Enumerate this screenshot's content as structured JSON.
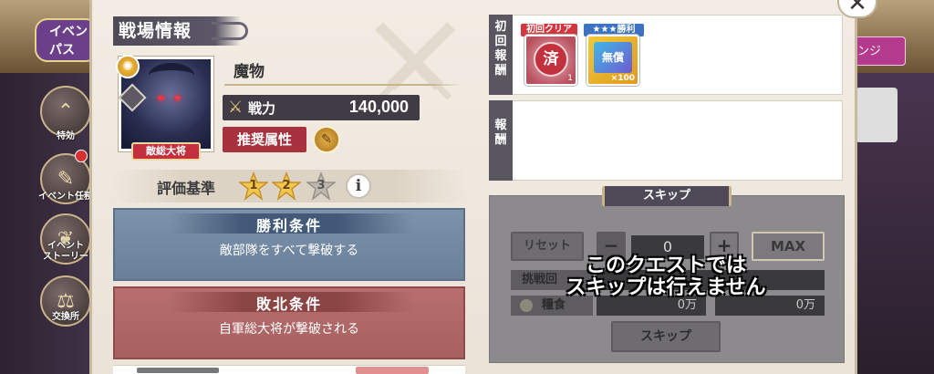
{
  "background": {
    "event_pass_label": "イベン\nパス",
    "change_label": "ンジ",
    "sidebar": [
      {
        "label": "特効",
        "icon": "chevron-up-icon"
      },
      {
        "label": "イベント任務",
        "icon": "mission-icon"
      },
      {
        "label": "イベント\nストーリー",
        "icon": "story-icon"
      },
      {
        "label": "交換所",
        "icon": "scales-icon"
      }
    ]
  },
  "dialog": {
    "close_label": "✕",
    "header": "戦場情報",
    "enemy": {
      "name": "魔物",
      "rank": "敵総大将",
      "power_label": "戦力",
      "power_value": "140,000",
      "recommended_attr_label": "推奨属性"
    },
    "criteria": {
      "label": "評価基準",
      "stars": [
        "1",
        "2",
        "3"
      ],
      "info_label": "i"
    },
    "win": {
      "title": "勝利条件",
      "text": "敵部隊をすべて撃破する"
    },
    "lose": {
      "title": "敗北条件",
      "text": "自軍総大将が撃破される"
    },
    "first_clear": {
      "label": "初回報酬",
      "items": [
        {
          "tag": "初回クリア",
          "glyph": "済",
          "count": "1"
        },
        {
          "tag": "★★★勝利",
          "glyph": "無償",
          "count": "×100"
        }
      ]
    },
    "reward": {
      "label": "報酬"
    },
    "skip": {
      "header": "スキップ",
      "reset_label": "リセット",
      "minus_label": "−",
      "count": "0",
      "plus_label": "+",
      "max_label": "MAX",
      "attempts_label": "挑戦回",
      "food_label": "糧食",
      "food_value_1": "0万",
      "food_value_2": "0万",
      "skip_button_label": "スキップ",
      "overlay_message_1": "このクエストでは",
      "overlay_message_2": "スキップは行えません"
    }
  }
}
